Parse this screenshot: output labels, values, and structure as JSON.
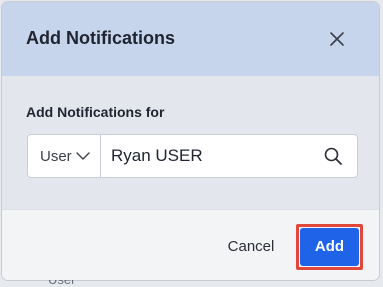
{
  "dialog": {
    "title": "Add Notifications",
    "field_label": "Add Notifications for",
    "type_select": "User",
    "search_value": "Ryan USER",
    "cancel_label": "Cancel",
    "add_label": "Add"
  },
  "background": {
    "partial_text": "User"
  },
  "icons": {
    "close": "close-icon",
    "chevron": "chevron-down-icon",
    "search": "search-icon"
  },
  "colors": {
    "header": "#c6d4ec",
    "primary": "#1f63e8",
    "highlight": "#e2473b"
  }
}
